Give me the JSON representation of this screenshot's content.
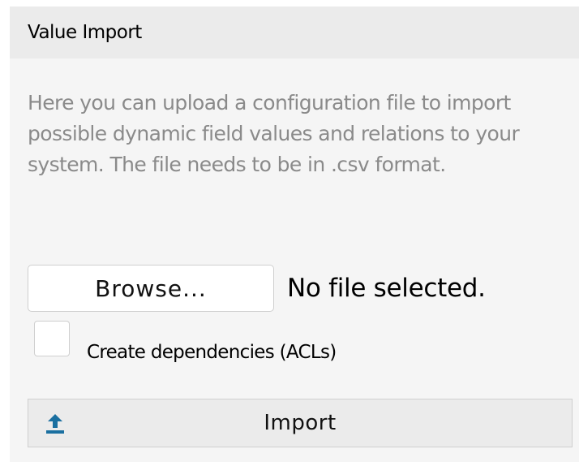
{
  "panel": {
    "title": "Value Import",
    "description": "Here you can upload a configuration file to import possible dynamic field values and relations to your system. The file needs to be in .csv format."
  },
  "file_input": {
    "browse_label": "Browse...",
    "status_text": "No file selected."
  },
  "dependencies": {
    "label": "Create dependencies (ACLs)",
    "checked": false
  },
  "import_button": {
    "icon": "upload-icon",
    "label": "Import"
  },
  "colors": {
    "panel_background": "#f5f5f5",
    "header_background": "#ebebeb",
    "description_text": "#8a8a8a",
    "icon_accent": "#1a6fa0"
  }
}
